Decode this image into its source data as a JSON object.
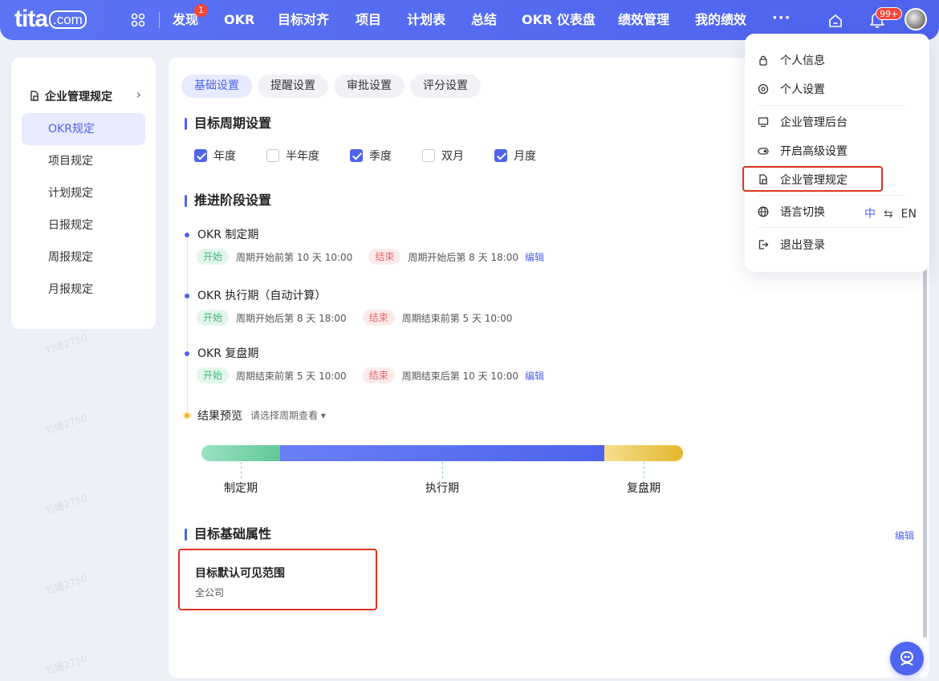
{
  "app": {
    "logo_text": "tita",
    "logo_suffix": ".com"
  },
  "nav": {
    "items": [
      "发现",
      "OKR",
      "目标对齐",
      "项目",
      "计划表",
      "总结",
      "OKR 仪表盘",
      "绩效管理",
      "我的绩效"
    ],
    "discover_badge": "1",
    "more": "···",
    "notification_badge": "99+"
  },
  "sidebar": {
    "heading": "企业管理规定",
    "items": [
      "OKR规定",
      "项目规定",
      "计划规定",
      "日报规定",
      "周报规定",
      "月报规定"
    ],
    "active_index": 0
  },
  "tabs": [
    "基础设置",
    "提醒设置",
    "审批设置",
    "评分设置"
  ],
  "cycle": {
    "title": "目标周期设置",
    "options": [
      {
        "label": "年度",
        "checked": true
      },
      {
        "label": "半年度",
        "checked": false
      },
      {
        "label": "季度",
        "checked": true
      },
      {
        "label": "双月",
        "checked": false
      },
      {
        "label": "月度",
        "checked": true
      }
    ]
  },
  "stages": {
    "title": "推进阶段设置",
    "start_tag": "开始",
    "end_tag": "结束",
    "edit_label": "编辑",
    "list": [
      {
        "name": "OKR 制定期",
        "start": "周期开始前第 10 天 10:00",
        "end": "周期开始后第 8 天 18:00",
        "editable": true
      },
      {
        "name": "OKR 执行期（自动计算）",
        "start": "周期开始后第 8 天 18:00",
        "end": "周期结束前第 5 天 10:00",
        "editable": false
      },
      {
        "name": "OKR 复盘期",
        "start": "周期结束前第 5 天 10:00",
        "end": "周期结束后第 10 天 10:00",
        "editable": true
      }
    ],
    "preview_label": "结果预览",
    "preview_select": "请选择周期查看 ▾",
    "bar_labels": [
      "制定期",
      "执行期",
      "复盘期"
    ]
  },
  "attributes": {
    "title": "目标基础属性",
    "edit_label": "编辑",
    "card_title": "目标默认可见范围",
    "card_value": "全公司"
  },
  "user_menu": {
    "items": [
      "个人信息",
      "个人设置",
      "企业管理后台",
      "开启高级设置",
      "企业管理规定",
      "语言切换",
      "退出登录"
    ],
    "lang_zh": "中",
    "lang_switch": "⇆",
    "lang_en": "EN"
  },
  "watermark": "刘珊2750",
  "colors": {
    "brand": "#4e63ee",
    "highlight": "#e0331f",
    "badge": "#f5463b"
  }
}
